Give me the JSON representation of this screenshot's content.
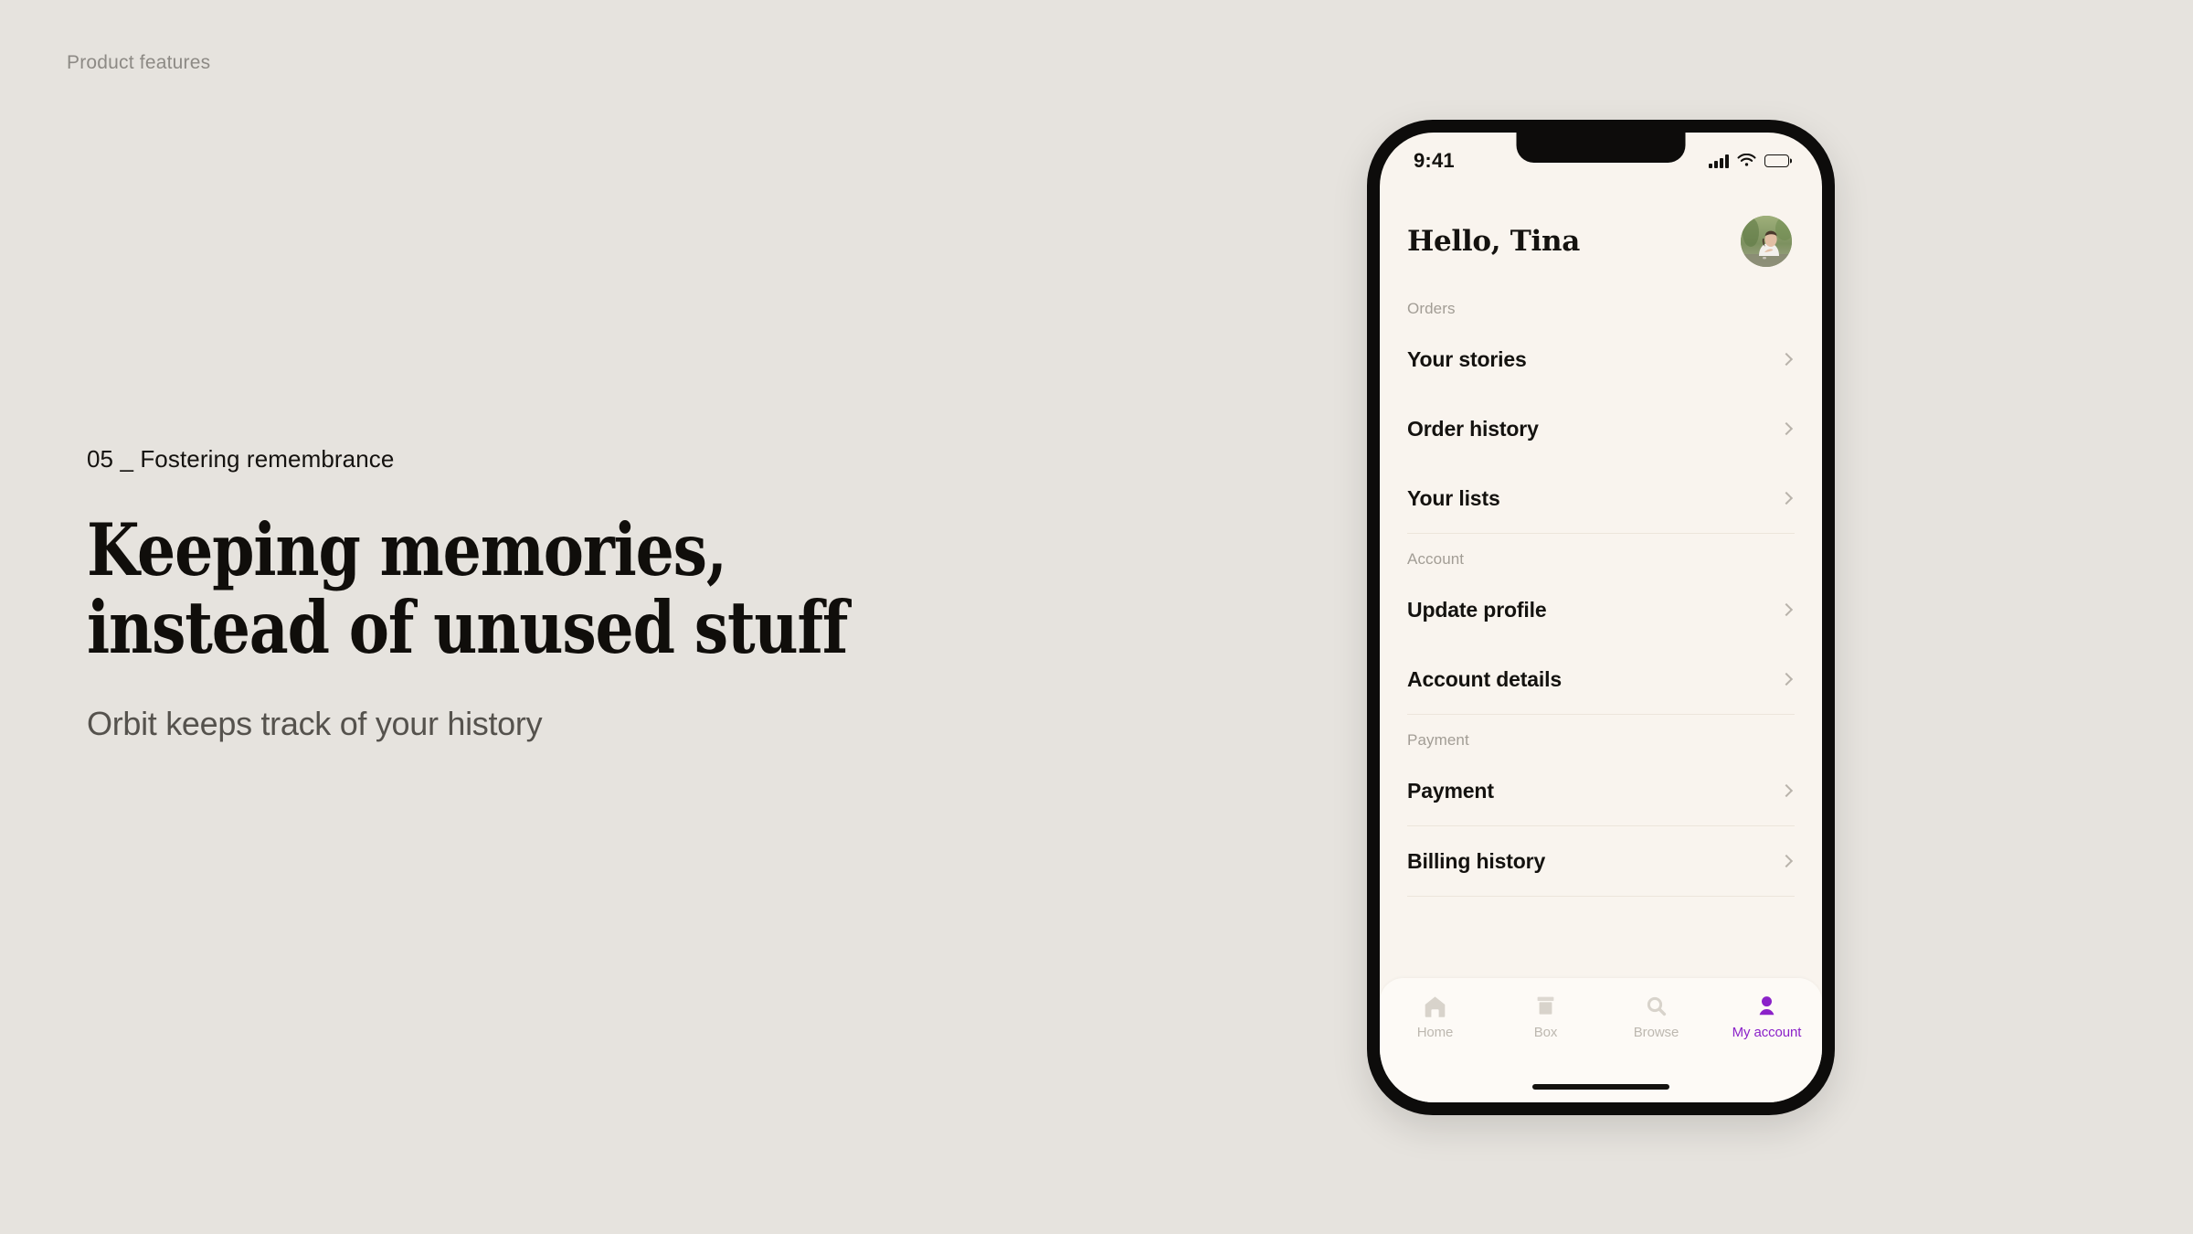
{
  "page": {
    "kicker": "Product features",
    "eyebrow": "05 _ Fostering remembrance",
    "headline_line_1": "Keeping memories,",
    "headline_line_2": "instead of unused stuff",
    "subhead": "Orbit keeps track of your history",
    "background_color": "#e6e3de"
  },
  "phone": {
    "status_bar": {
      "time": "9:41",
      "signal_icon": "cellular-signal-icon",
      "wifi_icon": "wifi-icon",
      "battery_icon": "battery-full-icon"
    },
    "header": {
      "greeting": "Hello, Tina",
      "avatar_icon": "user-avatar-photo"
    },
    "screen_background": "#f9f4ee",
    "accent_color": "#8b22c9",
    "sections": [
      {
        "label": "Orders",
        "items": [
          {
            "label": "Your stories"
          },
          {
            "label": "Order history"
          },
          {
            "label": "Your lists"
          }
        ]
      },
      {
        "label": "Account",
        "items": [
          {
            "label": "Update profile"
          },
          {
            "label": "Account details"
          }
        ]
      },
      {
        "label": "Payment",
        "items": [
          {
            "label": "Payment"
          },
          {
            "label": "Billing history"
          }
        ]
      }
    ],
    "tabs": [
      {
        "label": "Home",
        "icon": "home-icon",
        "active": false
      },
      {
        "label": "Box",
        "icon": "box-icon",
        "active": false
      },
      {
        "label": "Browse",
        "icon": "search-icon",
        "active": false
      },
      {
        "label": "My account",
        "icon": "person-icon",
        "active": true
      }
    ]
  }
}
